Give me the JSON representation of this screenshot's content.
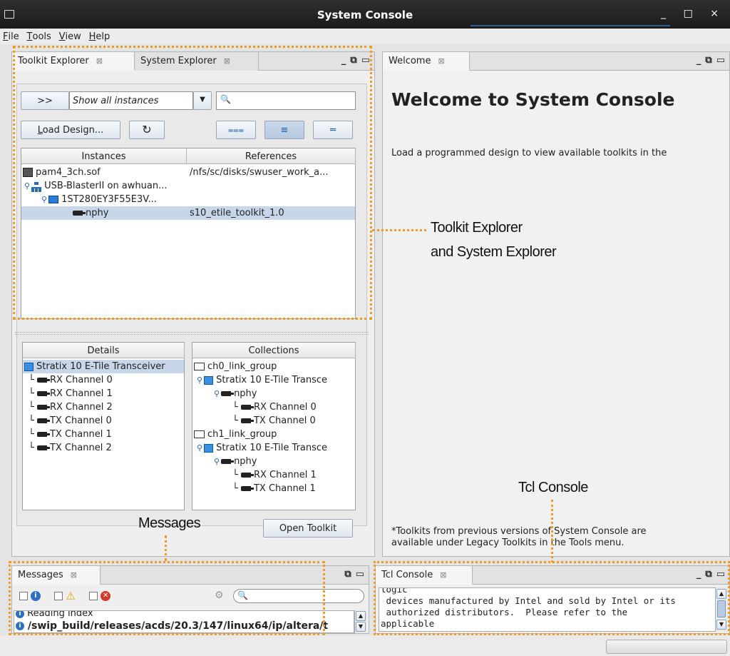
{
  "window": {
    "title": "System Console",
    "min": "_",
    "max": "□",
    "close": "×"
  },
  "menu": [
    {
      "accel": "F",
      "rest": "ile"
    },
    {
      "accel": "T",
      "rest": "ools"
    },
    {
      "accel": "V",
      "rest": "iew"
    },
    {
      "accel": "H",
      "rest": "elp"
    }
  ],
  "left_panel": {
    "tabs": [
      "Toolkit Explorer",
      "System Explorer"
    ],
    "expand_button": ">>",
    "filter_select": "Show all instances",
    "load_design": {
      "accel": "L",
      "rest": "oad Design..."
    },
    "columns": [
      "Instances",
      "References"
    ],
    "rows": [
      {
        "name": "pam4_3ch.sof",
        "ref": "/nfs/sc/disks/swuser_work_a..."
      },
      {
        "name": "USB-BlasterII on awhuan...",
        "ref": ""
      },
      {
        "name": "1ST280EY3F55E3V...",
        "ref": ""
      },
      {
        "name": "nphy",
        "ref": "s10_etile_toolkit_1.0"
      }
    ],
    "details_header": "Details",
    "details": [
      "Stratix 10 E-Tile Transceiver",
      "RX Channel 0",
      "RX Channel 1",
      "RX Channel 2",
      "TX Channel 0",
      "TX Channel 1",
      "TX Channel 2"
    ],
    "collections_header": "Collections",
    "collections": [
      "ch0_link_group",
      "Stratix 10 E-Tile Transce",
      "nphy",
      "RX Channel 0",
      "TX Channel 0",
      "ch1_link_group",
      "Stratix 10 E-Tile Transce",
      "nphy",
      "RX Channel 1",
      "TX Channel 1"
    ],
    "open_toolkit": "Open Toolkit"
  },
  "welcome": {
    "tab": "Welcome",
    "heading": "Welcome to System Console",
    "body": "Load a programmed design to view available toolkits in the",
    "footer_line1": "*Toolkits from previous versions of System Console are",
    "footer_line2": "available under Legacy Toolkits in the Tools menu."
  },
  "messages": {
    "tab": "Messages",
    "lines": [
      "Reading index",
      "/swip_build/releases/acds/20.3/147/linux64/ip/altera/t"
    ]
  },
  "tcl": {
    "tab": "Tcl Console",
    "lines": [
      "logic",
      " devices manufactured by Intel and sold by Intel or its",
      " authorized distributors.  Please refer to the",
      "applicable"
    ]
  },
  "annotations": {
    "toolkit_line1": "Toolkit Explorer",
    "toolkit_line2": "and System Explorer",
    "tcl": "Tcl Console",
    "messages": "Messages"
  },
  "colors": {
    "accent": "#ef9a2b",
    "selection": "#c7d6e9",
    "titlebar": "#1b1b1b"
  }
}
